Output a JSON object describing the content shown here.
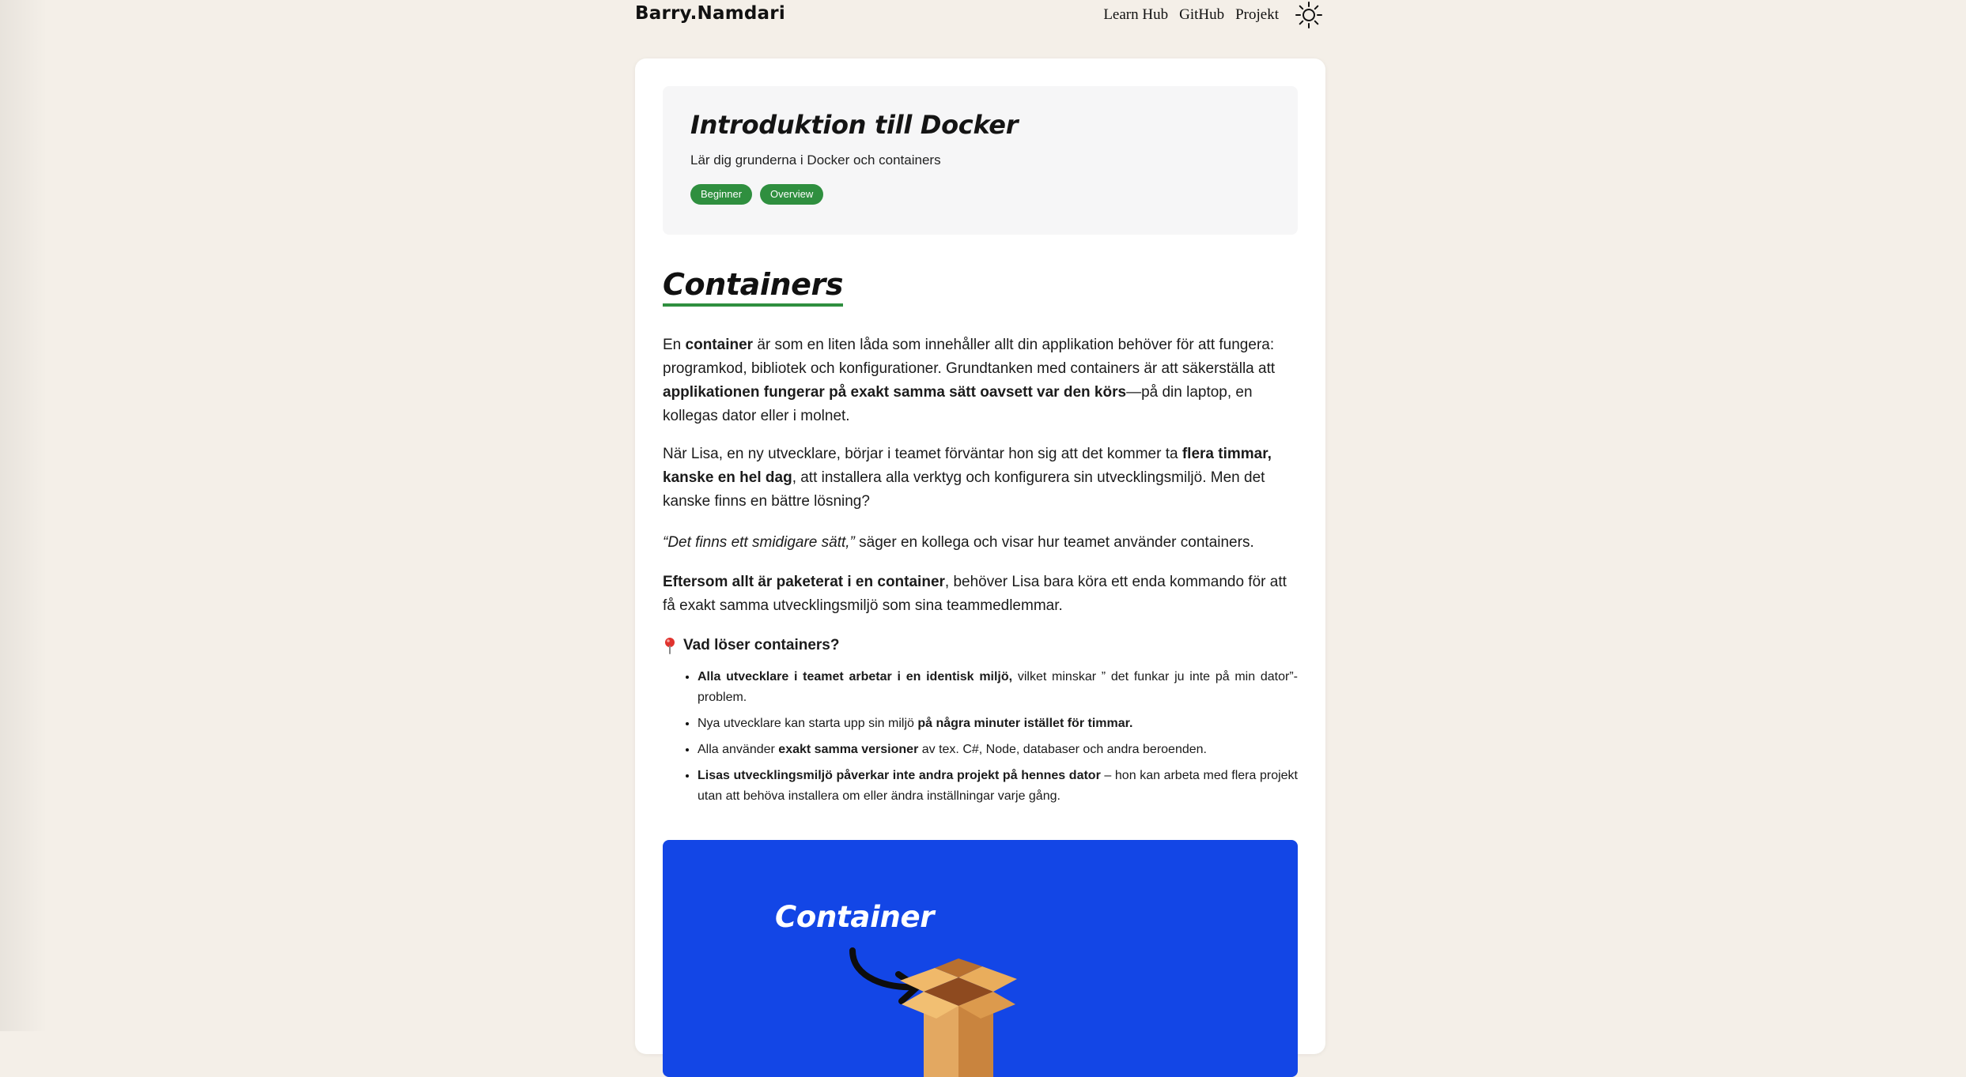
{
  "header": {
    "brand": "Barry.Namdari",
    "nav": [
      {
        "label": "Learn Hub"
      },
      {
        "label": "GitHub"
      },
      {
        "label": "Projekt"
      }
    ],
    "theme_toggle_icon": "sun-icon"
  },
  "hero": {
    "title": "Introduktion till Docker",
    "subtitle": "Lär dig grunderna i Docker och containers",
    "tags": [
      "Beginner",
      "Overview"
    ],
    "tag_color": "#2f8f3f"
  },
  "section": {
    "title": "Containers",
    "underline_color": "#2f8f3f",
    "p1": {
      "t1": "En ",
      "b1": "container",
      "t2": " är som en liten låda som innehåller allt din applikation behöver för att fungera: programkod, bibliotek och konfigurationer. Grundtanken med containers är att säkerställa att ",
      "b2": "applikationen fungerar på exakt samma sätt oavsett var den körs",
      "t3": "—på din laptop, en kollegas dator eller i molnet."
    },
    "p2": {
      "t1": "När Lisa, en ny utvecklare, börjar i teamet förväntar hon sig att det kommer ta ",
      "b1": "flera timmar, kanske en hel dag",
      "t2": ", att installera alla verktyg och konfigurera sin utvecklingsmiljö. Men det kanske finns en bättre lösning?"
    },
    "p3": {
      "i1": "“Det finns ett smidigare sätt,”",
      "t1": " säger en kollega och visar hur teamet använder containers."
    },
    "p4": {
      "b1": "Eftersom allt är paketerat i en container",
      "t1": ", behöver Lisa bara köra ett enda kommando för att få exakt samma utvecklingsmiljö som sina teammedlemmar."
    },
    "question_icon": "pin-icon",
    "question": "Vad löser containers?",
    "bullets": [
      {
        "b": "Alla utvecklare i teamet arbetar i en identisk miljö,",
        "t": " vilket minskar ” det funkar ju inte på min dator”-problem."
      },
      {
        "t": "Nya utvecklare kan starta upp sin miljö ",
        "b": "på några minuter istället för timmar."
      },
      {
        "t1": "Alla använder ",
        "b": "exakt samma versioner",
        "t2": " av tex. C#, Node, databaser och andra beroenden."
      },
      {
        "b": "Lisas utvecklingsmiljö påverkar inte andra projekt på hennes dator",
        "t": " – hon kan arbeta med flera projekt utan att behöva installera om eller ändra inställningar varje gång."
      }
    ],
    "illustration": {
      "label": "Container",
      "background": "#1346e6",
      "icons": [
        "arrow-icon",
        "open-box-icon"
      ]
    }
  }
}
